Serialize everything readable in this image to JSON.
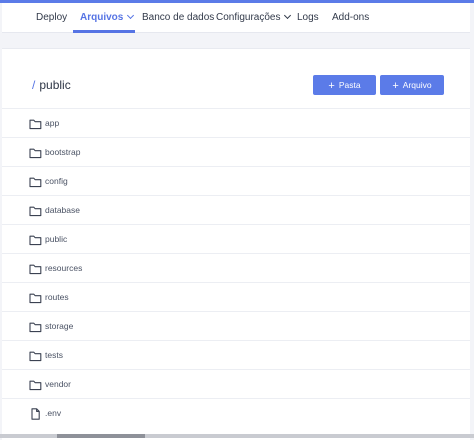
{
  "nav": {
    "items": [
      {
        "label": "Deploy",
        "active": false
      },
      {
        "label": "Arquivos",
        "active": true,
        "dropdown": true
      },
      {
        "label": "Banco de dados",
        "active": false
      },
      {
        "label": "Configurações",
        "active": false,
        "dropdown": true
      },
      {
        "label": "Logs",
        "active": false
      },
      {
        "label": "Add-ons",
        "active": false
      }
    ]
  },
  "breadcrumb": {
    "separator": "/",
    "path": "public"
  },
  "actions": {
    "new_folder_label": "Pasta",
    "new_file_label": "Arquivo"
  },
  "files": [
    {
      "name": "app",
      "type": "folder-icon"
    },
    {
      "name": "bootstrap",
      "type": "folder-icon"
    },
    {
      "name": "config",
      "type": "folder-icon"
    },
    {
      "name": "database",
      "type": "folder-icon"
    },
    {
      "name": "public",
      "type": "folder-icon"
    },
    {
      "name": "resources",
      "type": "folder-icon"
    },
    {
      "name": "routes",
      "type": "folder-icon"
    },
    {
      "name": "storage",
      "type": "folder-icon"
    },
    {
      "name": "tests",
      "type": "folder-icon"
    },
    {
      "name": "vendor",
      "type": "folder-icon"
    },
    {
      "name": ".env",
      "type": "file-icon"
    }
  ],
  "colors": {
    "accent": "#5b7be8",
    "active_nav": "#5674e4",
    "background": "#f3f4f8"
  }
}
